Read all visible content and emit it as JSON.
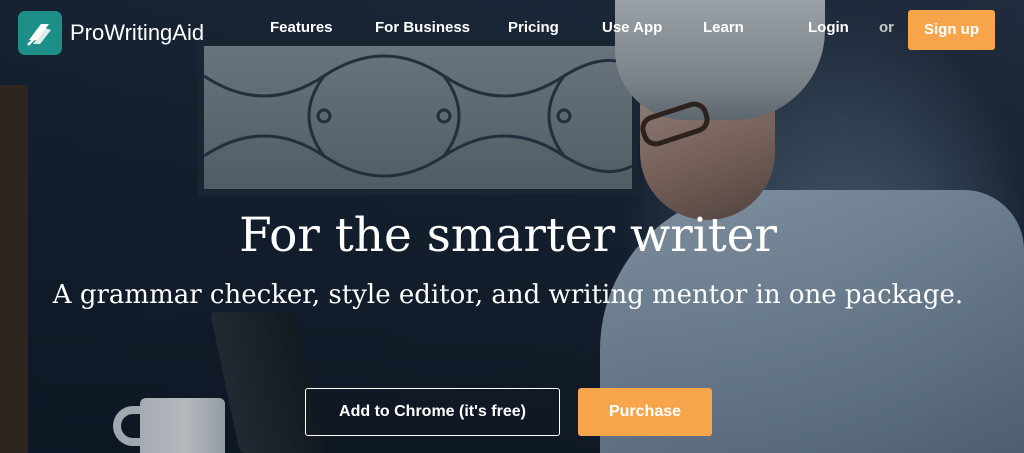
{
  "brand": {
    "name": "ProWritingAid",
    "accent": "#1d8f89"
  },
  "nav": {
    "items": [
      "Features",
      "For Business",
      "Pricing",
      "Use App",
      "Learn"
    ],
    "login": "Login",
    "or": "or",
    "signup": "Sign up"
  },
  "hero": {
    "title": "For the smarter writer",
    "subtitle": "A grammar checker, style editor, and writing mentor in one package.",
    "cta_chrome": "Add to Chrome (it's free)",
    "cta_purchase": "Purchase",
    "cta_color": "#f6a54a"
  }
}
